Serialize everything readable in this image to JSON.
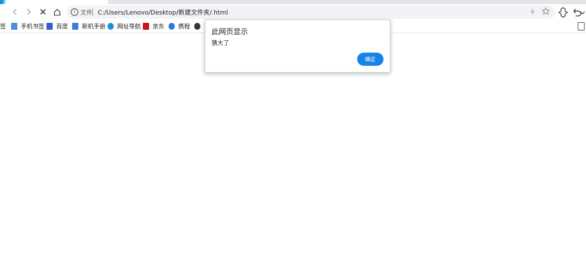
{
  "tabbar": {},
  "toolbar": {
    "back_icon": "chevron-left-icon",
    "forward_icon": "chevron-right-icon",
    "stop_icon": "close-icon",
    "home_icon": "home-icon"
  },
  "address_bar": {
    "scheme_label": "文件",
    "url": "C:/Users/Lenovo/Desktop/新建文件夹/.html"
  },
  "bookmarks": {
    "edge_label": "签",
    "items": [
      {
        "label": "手机书签",
        "icon": "phone-bookmark-icon",
        "color": "#4a90d9"
      },
      {
        "label": "百度",
        "icon": "baidu-icon",
        "color": "#3b5dcc"
      },
      {
        "label": "新机手册",
        "icon": "manual-icon",
        "color": "#3b7dd8"
      },
      {
        "label": "网址导航",
        "icon": "navigation-icon",
        "color": "#1a8fd8"
      },
      {
        "label": "京东",
        "icon": "jd-icon",
        "color": "#c9151e"
      },
      {
        "label": "携程",
        "icon": "ctrip-icon",
        "color": "#2577e3"
      }
    ]
  },
  "alert": {
    "title": "此网页显示",
    "message": "猜大了",
    "ok_label": "确定",
    "button_color": "#1783e6"
  }
}
